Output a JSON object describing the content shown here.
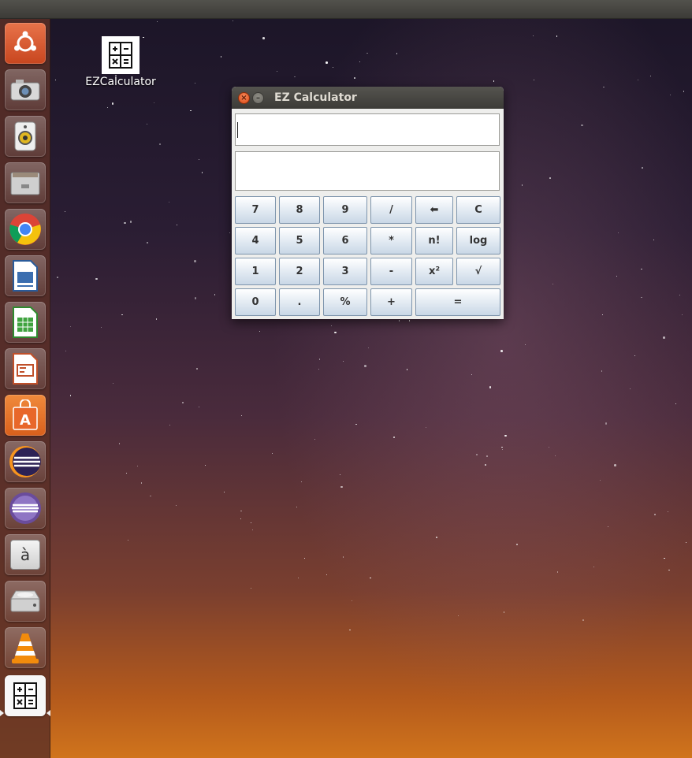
{
  "desktop": {
    "icon_label": "EZCalculator"
  },
  "launcher": {
    "items": [
      {
        "name": "ubuntu-dash-icon"
      },
      {
        "name": "shotwell-camera-icon"
      },
      {
        "name": "rhythmbox-speaker-icon"
      },
      {
        "name": "files-cabinet-icon"
      },
      {
        "name": "chrome-icon"
      },
      {
        "name": "libreoffice-writer-icon"
      },
      {
        "name": "libreoffice-calc-icon"
      },
      {
        "name": "libreoffice-impress-icon"
      },
      {
        "name": "software-center-icon"
      },
      {
        "name": "eclipse-icon"
      },
      {
        "name": "eclipse-alt-icon"
      },
      {
        "name": "character-map-icon",
        "glyph": "à"
      },
      {
        "name": "disk-drive-icon"
      },
      {
        "name": "vlc-cone-icon"
      },
      {
        "name": "ezcalculator-icon"
      }
    ]
  },
  "window": {
    "title": "EZ Calculator",
    "input_value": "",
    "result_value": "",
    "buttons": {
      "r1": [
        "7",
        "8",
        "9",
        "/",
        "⬅",
        "C"
      ],
      "r2": [
        "4",
        "5",
        "6",
        "*",
        "n!",
        "log"
      ],
      "r3": [
        "1",
        "2",
        "3",
        "-",
        "x²",
        "√"
      ],
      "r4": [
        "0",
        ".",
        "%",
        "+",
        "="
      ]
    }
  },
  "colors": {
    "close_button": "#df4a16",
    "launcher_bg": "#5c3026",
    "button_border": "#7e95ad"
  }
}
